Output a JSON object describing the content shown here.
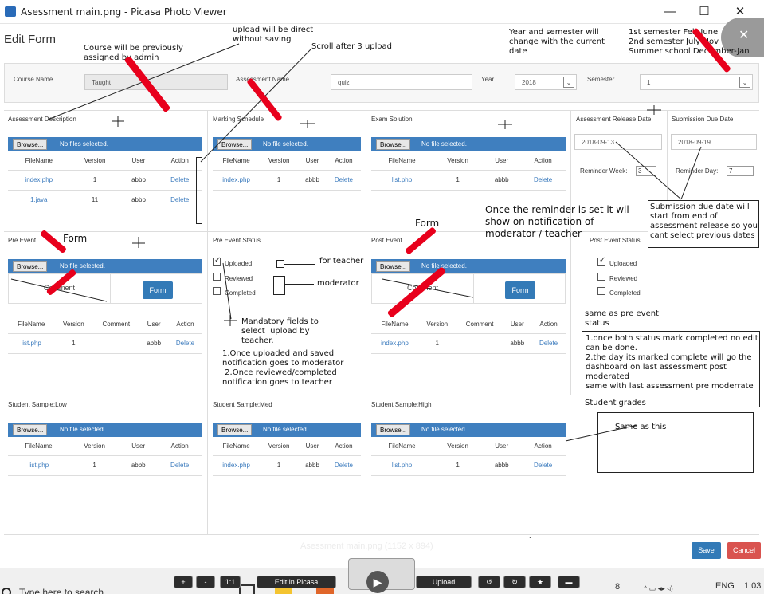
{
  "window": {
    "title": "Asessment main.png - Picasa Photo Viewer",
    "minimize": "—",
    "maximize": "☐",
    "close": "✕",
    "close_x": "✕"
  },
  "page": {
    "title": "Edit Form"
  },
  "annotations": {
    "upload_direct": "upload will be direct\nwithout saving",
    "scroll_after": "Scroll after 3 upload",
    "course_previous": "Course will be previously\nassigned by admin",
    "year_semester": "Year and semester will\nchange with the current\ndate",
    "semesters": "1st semester Feb-June\n2nd semester July-Nov\nSummer school December-Jan",
    "reminder_note": "Once the reminder is set it wll\nshow on notification of\nmoderator / teacher",
    "submission_note": "Submission due date will\nstart from end of\nassessment release so you\ncant select previous dates",
    "form_label_1": "Form",
    "form_label_2": "Form",
    "for_teacher": "for teacher",
    "moderator": "moderator",
    "mandatory": "Mandatory fields to\nselect  upload by\nteacher.",
    "notif_steps": "1.Once uploaded and saved\nnotification goes to moderator\n 2.Once reviewed/completed\nnotification goes to teacher",
    "same_pre": "same as pre event\nstatus",
    "both_status": "1.once both status mark completed no edit\ncan be done.\n2.the day its marked complete will go the\ndashboard on last assessment post\nmoderated\nsame with last assessment pre moderrate",
    "student_grades": "Student grades",
    "same_as_this": "Same as this"
  },
  "header_fields": {
    "course_label": "Course Name",
    "course_value": "Taught",
    "assessment_label": "Assessment Name",
    "assessment_value": "quiz",
    "year_label": "Year",
    "year_value": "2018",
    "semester_label": "Semester",
    "semester_value": "1"
  },
  "sections": {
    "assessment_description": "Assessment Description",
    "marking_schedule": "Marking Schedule",
    "exam_solution": "Exam Solution",
    "release_date": "Assessment Release Date",
    "due_date": "Submission Due Date",
    "pre_event": "Pre Event",
    "pre_event_status": "Pre Event Status",
    "post_event": "Post Event",
    "post_event_status": "Post Event Status",
    "sample_low": "Student Sample:Low",
    "sample_med": "Student Sample:Med",
    "sample_high": "Student Sample:High"
  },
  "browse": {
    "button": "Browse...",
    "no_file": "No file selected.",
    "no_files": "No files selected."
  },
  "dates": {
    "release": "2018-09-13",
    "due": "2018-09-19",
    "reminder_week_label": "Reminder Week:",
    "reminder_week": "3",
    "reminder_day_label": "Reminder Day:",
    "reminder_day": "7"
  },
  "cols4": {
    "file": "FileName",
    "version": "Version",
    "user": "User",
    "action": "Action"
  },
  "cols5": {
    "file": "FileName",
    "version": "Version",
    "comment": "Comment",
    "user": "User",
    "action": "Action"
  },
  "assess_rows": [
    {
      "file": "index.php",
      "version": "1",
      "user": "abbb",
      "action": "Delete"
    },
    {
      "file": "1.java",
      "version": "11",
      "user": "abbb",
      "action": "Delete"
    }
  ],
  "marking_row": {
    "file": "index.php",
    "version": "1",
    "user": "abbb",
    "action": "Delete"
  },
  "exam_row": {
    "file": "list.php",
    "version": "1",
    "user": "abbb",
    "action": "Delete"
  },
  "pre_row": {
    "file": "list.php",
    "version": "1",
    "comment": "",
    "user": "abbb",
    "action": "Delete"
  },
  "post_row": {
    "file": "index.php",
    "version": "1",
    "comment": "",
    "user": "abbb",
    "action": "Delete"
  },
  "comment_label": "Comment",
  "form_button": "Form",
  "status": {
    "uploaded": "Uploaded",
    "reviewed": "Reviewed",
    "completed": "Completed"
  },
  "low_row": {
    "file": "list.php",
    "version": "1",
    "user": "abbb",
    "action": "Delete"
  },
  "med_row": {
    "file": "index.php",
    "version": "1",
    "user": "abbb",
    "action": "Delete"
  },
  "high_row": {
    "file": "list.php",
    "version": "1",
    "user": "abbb",
    "action": "Delete"
  },
  "footer": {
    "save": "Save",
    "cancel": "Cancel",
    "caption": "Asessment main.png (1152 x 894)",
    "backtick": "`"
  },
  "picasa": {
    "plus": "+",
    "minus": "-",
    "one": "1:1",
    "edit": "Edit in Picasa",
    "upload": "Upload"
  },
  "taskbar": {
    "search": "Type here to search",
    "lang": "ENG",
    "time": "1:03",
    "people": "8"
  },
  "colors": {
    "accent": "#3f7fbf",
    "save": "#337ab7",
    "cancel": "#d9534f",
    "marker": "#e8001c"
  }
}
